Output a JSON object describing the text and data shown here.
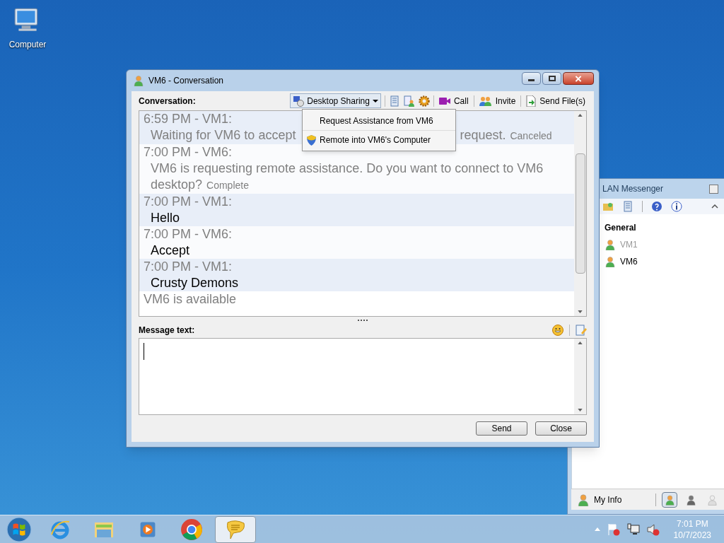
{
  "desktop_icons": [
    {
      "label": "Computer"
    }
  ],
  "conversation_window": {
    "title": "VM6 - Conversation",
    "conversation_label": "Conversation:",
    "desktop_sharing": {
      "label": "Desktop Sharing",
      "open": true,
      "menu": [
        {
          "label": "Request Assistance from VM6",
          "kind": "plain"
        },
        {
          "label": "Remote into VM6's Computer",
          "kind": "shield"
        }
      ]
    },
    "toolbar_buttons": [
      {
        "label": "Call",
        "kind": "video"
      },
      {
        "label": "Invite",
        "kind": "invite"
      },
      {
        "label": "Send File(s)",
        "kind": "file"
      }
    ],
    "messages": [
      {
        "header": "6:59 PM - VM1:",
        "mine": true,
        "kind": "system",
        "lines": [
          [
            "Waiting for VM6 to accept",
            "request."
          ]
        ],
        "status": "Canceled"
      },
      {
        "header": "7:00 PM - VM6:",
        "mine": false,
        "kind": "system",
        "lines": [
          [
            "VM6 is requesting remote assistance. Do you want to connect to VM6"
          ],
          [
            "desktop?"
          ]
        ],
        "status": "Complete"
      },
      {
        "header": "7:00 PM - VM1:",
        "mine": true,
        "kind": "chat",
        "lines": [
          [
            "Hello"
          ]
        ]
      },
      {
        "header": "7:00 PM - VM6:",
        "mine": false,
        "kind": "chat",
        "lines": [
          [
            "Accept"
          ]
        ]
      },
      {
        "header": "7:00 PM - VM1:",
        "mine": true,
        "kind": "chat",
        "lines": [
          [
            "Crusty Demons"
          ]
        ]
      }
    ],
    "presence_note": "VM6 is available",
    "message_label": "Message text:",
    "buttons": [
      "Send",
      "Close"
    ]
  },
  "messenger_window": {
    "title": "LAN Messenger",
    "group": "General",
    "users": [
      {
        "name": "VM1",
        "online": false
      },
      {
        "name": "VM6",
        "online": true
      }
    ],
    "my_info": "My Info",
    "status_buttons": [
      {
        "kind": "available",
        "selected": true
      },
      {
        "kind": "busy",
        "selected": false
      },
      {
        "kind": "offline",
        "selected": false
      }
    ]
  },
  "taskbar": {
    "apps": [
      {
        "kind": "ie",
        "active": false
      },
      {
        "kind": "explorer",
        "active": false
      },
      {
        "kind": "media",
        "active": false
      },
      {
        "kind": "chrome",
        "active": false
      },
      {
        "kind": "messenger",
        "active": true
      }
    ],
    "time": "7:01 PM",
    "date": "10/7/2023"
  }
}
